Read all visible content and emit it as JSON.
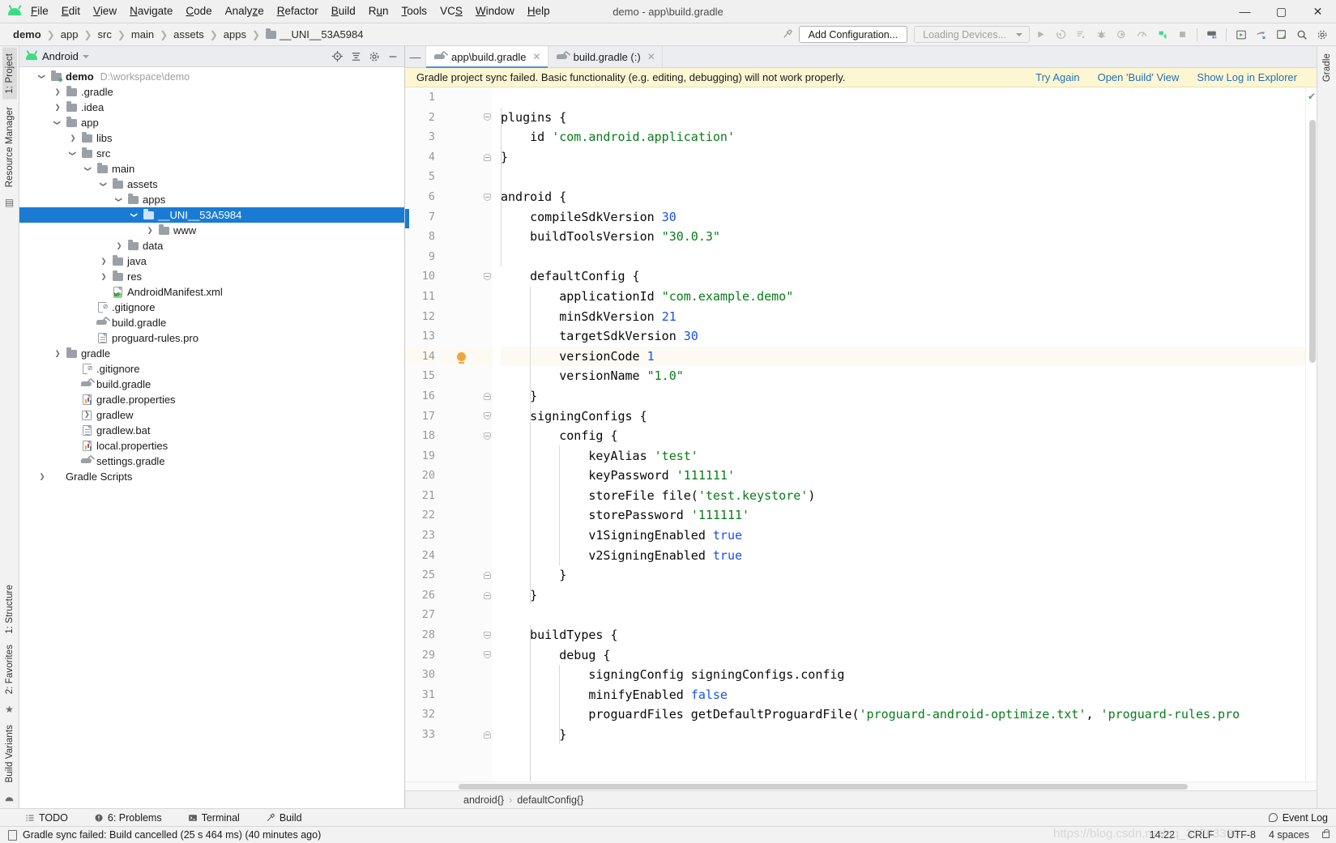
{
  "window": {
    "title": "demo - app\\build.gradle",
    "minimize": "—",
    "maximize": "▢",
    "close": "✕"
  },
  "menubar": [
    {
      "label": "File",
      "mnemonic": "F"
    },
    {
      "label": "Edit",
      "mnemonic": "E"
    },
    {
      "label": "View",
      "mnemonic": "V"
    },
    {
      "label": "Navigate",
      "mnemonic": "N"
    },
    {
      "label": "Code",
      "mnemonic": "C"
    },
    {
      "label": "Analyze",
      "mnemonic": "z"
    },
    {
      "label": "Refactor",
      "mnemonic": "R"
    },
    {
      "label": "Build",
      "mnemonic": "B"
    },
    {
      "label": "Run",
      "mnemonic": "u"
    },
    {
      "label": "Tools",
      "mnemonic": "T"
    },
    {
      "label": "VCS",
      "mnemonic": "S"
    },
    {
      "label": "Window",
      "mnemonic": "W"
    },
    {
      "label": "Help",
      "mnemonic": "H"
    }
  ],
  "breadcrumbs": [
    {
      "label": "demo",
      "bold": true,
      "folder": false
    },
    {
      "label": "app",
      "bold": false,
      "folder": false
    },
    {
      "label": "src",
      "bold": false,
      "folder": false
    },
    {
      "label": "main",
      "bold": false,
      "folder": false
    },
    {
      "label": "assets",
      "bold": false,
      "folder": false
    },
    {
      "label": "apps",
      "bold": false,
      "folder": false
    },
    {
      "label": "__UNI__53A5984",
      "bold": false,
      "folder": true
    }
  ],
  "toolbar": {
    "add_configuration": "Add Configuration...",
    "loading_devices": "Loading Devices...",
    "icons": [
      "run-icon",
      "rerun-icon",
      "run-with-coverage-icon",
      "debug-icon",
      "profile-icon",
      "stop-icon-1",
      "apply-changes-icon",
      "stop-icon",
      "avd-manager-icon",
      "sdk-manager-icon",
      "gradle-sync-icon",
      "layout-inspector-icon",
      "search-icon",
      "settings-icon"
    ]
  },
  "left_rail": {
    "top_tabs": [
      "1: Project"
    ],
    "vertical_tabs": [
      "Resource Manager"
    ],
    "bottom_tabs": [
      "1: Structure",
      "2: Favorites",
      "Build Variants"
    ]
  },
  "right_rail": {
    "tabs": [
      "Gradle"
    ]
  },
  "project_panel": {
    "title": "Android",
    "header_icons": [
      "locate-icon",
      "collapse-all-icon",
      "settings-icon",
      "hide-icon"
    ],
    "tree": [
      {
        "depth": 0,
        "twist": "down",
        "icon": "folder-module",
        "label": "demo",
        "bold": true,
        "path": "D:\\workspace\\demo",
        "selected": false
      },
      {
        "depth": 1,
        "twist": "right",
        "icon": "folder",
        "label": ".gradle",
        "bold": false,
        "path": "",
        "selected": false
      },
      {
        "depth": 1,
        "twist": "right",
        "icon": "folder",
        "label": ".idea",
        "bold": false,
        "path": "",
        "selected": false
      },
      {
        "depth": 1,
        "twist": "down",
        "icon": "folder",
        "label": "app",
        "bold": false,
        "path": "",
        "selected": false
      },
      {
        "depth": 2,
        "twist": "right",
        "icon": "folder",
        "label": "libs",
        "bold": false,
        "path": "",
        "selected": false
      },
      {
        "depth": 2,
        "twist": "down",
        "icon": "folder",
        "label": "src",
        "bold": false,
        "path": "",
        "selected": false
      },
      {
        "depth": 3,
        "twist": "down",
        "icon": "folder",
        "label": "main",
        "bold": false,
        "path": "",
        "selected": false
      },
      {
        "depth": 4,
        "twist": "down",
        "icon": "folder",
        "label": "assets",
        "bold": false,
        "path": "",
        "selected": false
      },
      {
        "depth": 5,
        "twist": "down",
        "icon": "folder",
        "label": "apps",
        "bold": false,
        "path": "",
        "selected": false
      },
      {
        "depth": 6,
        "twist": "down",
        "icon": "folder",
        "label": "__UNI__53A5984",
        "bold": false,
        "path": "",
        "selected": true
      },
      {
        "depth": 7,
        "twist": "right",
        "icon": "folder",
        "label": "www",
        "bold": false,
        "path": "",
        "selected": false
      },
      {
        "depth": 5,
        "twist": "right",
        "icon": "folder",
        "label": "data",
        "bold": false,
        "path": "",
        "selected": false
      },
      {
        "depth": 4,
        "twist": "right",
        "icon": "folder",
        "label": "java",
        "bold": false,
        "path": "",
        "selected": false
      },
      {
        "depth": 4,
        "twist": "right",
        "icon": "folder",
        "label": "res",
        "bold": false,
        "path": "",
        "selected": false
      },
      {
        "depth": 4,
        "twist": "none",
        "icon": "manifest",
        "label": "AndroidManifest.xml",
        "bold": false,
        "path": "",
        "selected": false
      },
      {
        "depth": 3,
        "twist": "none",
        "icon": "gitignore",
        "label": ".gitignore",
        "bold": false,
        "path": "",
        "selected": false
      },
      {
        "depth": 3,
        "twist": "none",
        "icon": "gradle-file",
        "label": "build.gradle",
        "bold": false,
        "path": "",
        "selected": false
      },
      {
        "depth": 3,
        "twist": "none",
        "icon": "text-file",
        "label": "proguard-rules.pro",
        "bold": false,
        "path": "",
        "selected": false
      },
      {
        "depth": 1,
        "twist": "right",
        "icon": "folder",
        "label": "gradle",
        "bold": false,
        "path": "",
        "selected": false
      },
      {
        "depth": 2,
        "twist": "none",
        "icon": "gitignore",
        "label": ".gitignore",
        "bold": false,
        "path": "",
        "selected": false
      },
      {
        "depth": 2,
        "twist": "none",
        "icon": "gradle-file",
        "label": "build.gradle",
        "bold": false,
        "path": "",
        "selected": false
      },
      {
        "depth": 2,
        "twist": "none",
        "icon": "properties",
        "label": "gradle.properties",
        "bold": false,
        "path": "",
        "selected": false
      },
      {
        "depth": 2,
        "twist": "none",
        "icon": "shell",
        "label": "gradlew",
        "bold": false,
        "path": "",
        "selected": false
      },
      {
        "depth": 2,
        "twist": "none",
        "icon": "text-file",
        "label": "gradlew.bat",
        "bold": false,
        "path": "",
        "selected": false
      },
      {
        "depth": 2,
        "twist": "none",
        "icon": "properties",
        "label": "local.properties",
        "bold": false,
        "path": "",
        "selected": false
      },
      {
        "depth": 2,
        "twist": "none",
        "icon": "gradle-file",
        "label": "settings.gradle",
        "bold": false,
        "path": "",
        "selected": false
      },
      {
        "depth": 0,
        "twist": "right",
        "icon": "none",
        "label": "Gradle Scripts",
        "bold": false,
        "path": "",
        "selected": false
      }
    ]
  },
  "editor": {
    "tabs": [
      {
        "label": "app\\build.gradle",
        "active": true,
        "close": "✕"
      },
      {
        "label": "build.gradle (:)",
        "active": false,
        "close": "✕"
      }
    ],
    "notification": {
      "message": "Gradle project sync failed. Basic functionality (e.g. editing, debugging) will not work properly.",
      "actions": [
        "Try Again",
        "Open 'Build' View",
        "Show Log in Explorer"
      ]
    },
    "breadcrumb": [
      "android{}",
      "defaultConfig{}"
    ],
    "first_line_number": 1,
    "lines": [
      {
        "n": 1,
        "tokens": [],
        "fold": "",
        "bulb": false,
        "hl": false
      },
      {
        "n": 2,
        "tokens": [
          {
            "t": "plugins {",
            "c": "plain"
          }
        ],
        "fold": "open",
        "bulb": false,
        "hl": false
      },
      {
        "n": 3,
        "tokens": [
          {
            "t": "    id ",
            "c": "plain"
          },
          {
            "t": "'com.android.application'",
            "c": "str"
          }
        ],
        "fold": "",
        "bulb": false,
        "hl": false
      },
      {
        "n": 4,
        "tokens": [
          {
            "t": "}",
            "c": "plain"
          }
        ],
        "fold": "close",
        "bulb": false,
        "hl": false
      },
      {
        "n": 5,
        "tokens": [],
        "fold": "",
        "bulb": false,
        "hl": false
      },
      {
        "n": 6,
        "tokens": [
          {
            "t": "android {",
            "c": "plain"
          }
        ],
        "fold": "open",
        "bulb": false,
        "hl": false
      },
      {
        "n": 7,
        "tokens": [
          {
            "t": "    compileSdkVersion ",
            "c": "plain"
          },
          {
            "t": "30",
            "c": "num"
          }
        ],
        "fold": "",
        "bulb": false,
        "hl": false
      },
      {
        "n": 8,
        "tokens": [
          {
            "t": "    buildToolsVersion ",
            "c": "plain"
          },
          {
            "t": "\"30.0.3\"",
            "c": "str"
          }
        ],
        "fold": "",
        "bulb": false,
        "hl": false
      },
      {
        "n": 9,
        "tokens": [],
        "fold": "",
        "bulb": false,
        "hl": false
      },
      {
        "n": 10,
        "tokens": [
          {
            "t": "    defaultConfig {",
            "c": "plain"
          }
        ],
        "fold": "open",
        "bulb": false,
        "hl": false
      },
      {
        "n": 11,
        "tokens": [
          {
            "t": "        applicationId ",
            "c": "plain"
          },
          {
            "t": "\"com.example.demo\"",
            "c": "str"
          }
        ],
        "fold": "",
        "bulb": false,
        "hl": false
      },
      {
        "n": 12,
        "tokens": [
          {
            "t": "        minSdkVersion ",
            "c": "plain"
          },
          {
            "t": "21",
            "c": "num"
          }
        ],
        "fold": "",
        "bulb": false,
        "hl": false
      },
      {
        "n": 13,
        "tokens": [
          {
            "t": "        targetSdkVersion ",
            "c": "plain"
          },
          {
            "t": "30",
            "c": "num"
          }
        ],
        "fold": "",
        "bulb": false,
        "hl": false
      },
      {
        "n": 14,
        "tokens": [
          {
            "t": "        versionCode ",
            "c": "plain"
          },
          {
            "t": "1",
            "c": "num"
          }
        ],
        "fold": "",
        "bulb": true,
        "hl": true
      },
      {
        "n": 15,
        "tokens": [
          {
            "t": "        versionName ",
            "c": "plain"
          },
          {
            "t": "\"1.0\"",
            "c": "str"
          }
        ],
        "fold": "",
        "bulb": false,
        "hl": false
      },
      {
        "n": 16,
        "tokens": [
          {
            "t": "    }",
            "c": "plain"
          }
        ],
        "fold": "close",
        "bulb": false,
        "hl": false
      },
      {
        "n": 17,
        "tokens": [
          {
            "t": "    signingConfigs {",
            "c": "plain"
          }
        ],
        "fold": "open",
        "bulb": false,
        "hl": false
      },
      {
        "n": 18,
        "tokens": [
          {
            "t": "        config {",
            "c": "plain"
          }
        ],
        "fold": "open",
        "bulb": false,
        "hl": false
      },
      {
        "n": 19,
        "tokens": [
          {
            "t": "            keyAlias ",
            "c": "plain"
          },
          {
            "t": "'test'",
            "c": "str"
          }
        ],
        "fold": "",
        "bulb": false,
        "hl": false
      },
      {
        "n": 20,
        "tokens": [
          {
            "t": "            keyPassword ",
            "c": "plain"
          },
          {
            "t": "'111111'",
            "c": "str"
          }
        ],
        "fold": "",
        "bulb": false,
        "hl": false
      },
      {
        "n": 21,
        "tokens": [
          {
            "t": "            storeFile file(",
            "c": "plain"
          },
          {
            "t": "'test.keystore'",
            "c": "str"
          },
          {
            "t": ")",
            "c": "plain"
          }
        ],
        "fold": "",
        "bulb": false,
        "hl": false
      },
      {
        "n": 22,
        "tokens": [
          {
            "t": "            storePassword ",
            "c": "plain"
          },
          {
            "t": "'111111'",
            "c": "str"
          }
        ],
        "fold": "",
        "bulb": false,
        "hl": false
      },
      {
        "n": 23,
        "tokens": [
          {
            "t": "            v1SigningEnabled ",
            "c": "plain"
          },
          {
            "t": "true",
            "c": "num"
          }
        ],
        "fold": "",
        "bulb": false,
        "hl": false
      },
      {
        "n": 24,
        "tokens": [
          {
            "t": "            v2SigningEnabled ",
            "c": "plain"
          },
          {
            "t": "true",
            "c": "num"
          }
        ],
        "fold": "",
        "bulb": false,
        "hl": false
      },
      {
        "n": 25,
        "tokens": [
          {
            "t": "        }",
            "c": "plain"
          }
        ],
        "fold": "close",
        "bulb": false,
        "hl": false
      },
      {
        "n": 26,
        "tokens": [
          {
            "t": "    }",
            "c": "plain"
          }
        ],
        "fold": "close",
        "bulb": false,
        "hl": false
      },
      {
        "n": 27,
        "tokens": [],
        "fold": "",
        "bulb": false,
        "hl": false
      },
      {
        "n": 28,
        "tokens": [
          {
            "t": "    buildTypes {",
            "c": "plain"
          }
        ],
        "fold": "open",
        "bulb": false,
        "hl": false
      },
      {
        "n": 29,
        "tokens": [
          {
            "t": "        debug {",
            "c": "plain"
          }
        ],
        "fold": "open",
        "bulb": false,
        "hl": false
      },
      {
        "n": 30,
        "tokens": [
          {
            "t": "            signingConfig signingConfigs.config",
            "c": "plain"
          }
        ],
        "fold": "",
        "bulb": false,
        "hl": false
      },
      {
        "n": 31,
        "tokens": [
          {
            "t": "            minifyEnabled ",
            "c": "plain"
          },
          {
            "t": "false",
            "c": "num"
          }
        ],
        "fold": "",
        "bulb": false,
        "hl": false
      },
      {
        "n": 32,
        "tokens": [
          {
            "t": "            proguardFiles getDefaultProguardFile(",
            "c": "plain"
          },
          {
            "t": "'proguard-android-optimize.txt'",
            "c": "str"
          },
          {
            "t": ", ",
            "c": "plain"
          },
          {
            "t": "'proguard-rules.pro",
            "c": "str"
          }
        ],
        "fold": "",
        "bulb": false,
        "hl": false
      },
      {
        "n": 33,
        "tokens": [
          {
            "t": "        }",
            "c": "plain"
          }
        ],
        "fold": "close",
        "bulb": false,
        "hl": false
      }
    ]
  },
  "bottom_tools": [
    {
      "label": "TODO",
      "icon": "todo-icon"
    },
    {
      "label": "6: Problems",
      "icon": "problems-icon"
    },
    {
      "label": "Terminal",
      "icon": "terminal-icon"
    },
    {
      "label": "Build",
      "icon": "build-icon"
    }
  ],
  "event_log": "Event Log",
  "statusbar": {
    "message": "Gradle sync failed: Build cancelled (25 s 464 ms) (40 minutes ago)",
    "time": "14:22",
    "line_sep": "CRLF",
    "encoding": "UTF-8",
    "indent": "4 spaces",
    "lock": "lock-icon",
    "watermark": "https://blog.csdn.net/qq_33763399"
  },
  "colors": {
    "accent_blue": "#1a7bd4",
    "link_blue": "#2470b3",
    "notification_bg": "#fdf6d3",
    "string_green": "#067d17",
    "number_blue": "#1750eb",
    "android_green": "#3ddc84",
    "bulb_orange": "#f2a33c"
  }
}
